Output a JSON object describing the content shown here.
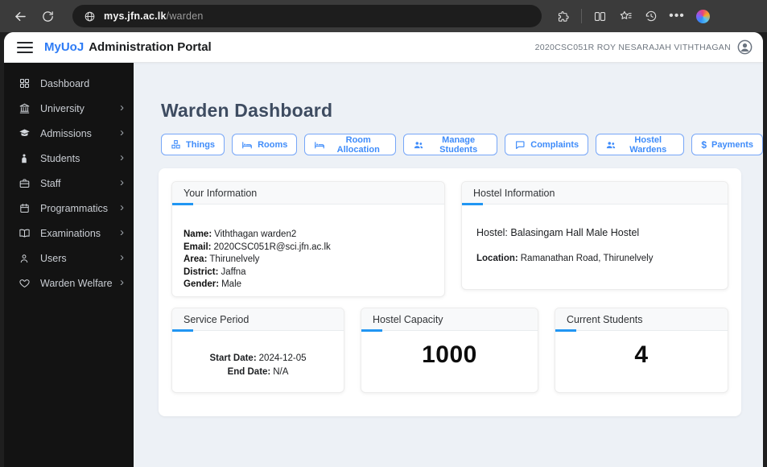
{
  "browser": {
    "url_domain": "mys.jfn.ac.lk",
    "url_path": "/warden",
    "icons": [
      "back-icon",
      "refresh-icon",
      "globe-icon",
      "extensions-icon",
      "split-screen-icon",
      "favorites-icon",
      "history-icon",
      "more-icon",
      "copilot-icon"
    ]
  },
  "header": {
    "brand": "MyUoJ",
    "title": "Administration Portal",
    "user": "2020CSC051R ROY NESARAJAH VITHTHAGAN"
  },
  "sidebar": {
    "items": [
      {
        "label": "Dashboard",
        "icon": "grid-icon",
        "has_submenu": false
      },
      {
        "label": "University",
        "icon": "building-icon",
        "has_submenu": true
      },
      {
        "label": "Admissions",
        "icon": "graduation-cap-icon",
        "has_submenu": true
      },
      {
        "label": "Students",
        "icon": "student-icon",
        "has_submenu": true
      },
      {
        "label": "Staff",
        "icon": "briefcase-icon",
        "has_submenu": true
      },
      {
        "label": "Programmatics",
        "icon": "calendar-icon",
        "has_submenu": true
      },
      {
        "label": "Examinations",
        "icon": "open-book-icon",
        "has_submenu": true
      },
      {
        "label": "Users",
        "icon": "user-icon",
        "has_submenu": true
      },
      {
        "label": "Warden Welfare",
        "icon": "heart-icon",
        "has_submenu": true
      }
    ]
  },
  "main": {
    "page_title": "Warden Dashboard",
    "actions": [
      {
        "label": "Things",
        "icon": "boxes-icon"
      },
      {
        "label": "Rooms",
        "icon": "bed-icon"
      },
      {
        "label": "Room Allocation",
        "icon": "bed-icon"
      },
      {
        "label": "Manage Students",
        "icon": "users-icon"
      },
      {
        "label": "Complaints",
        "icon": "chat-icon"
      },
      {
        "label": "Hostel Wardens",
        "icon": "users-icon"
      },
      {
        "label": "Payments",
        "icon": "dollar-icon"
      }
    ],
    "your_information": {
      "title": "Your Information",
      "fields": [
        {
          "label": "Name:",
          "value": "Viththagan warden2"
        },
        {
          "label": "Email:",
          "value": "2020CSC051R@sci.jfn.ac.lk"
        },
        {
          "label": "Area:",
          "value": "Thirunelvely"
        },
        {
          "label": "District:",
          "value": "Jaffna"
        },
        {
          "label": "Gender:",
          "value": "Male"
        }
      ]
    },
    "hostel_information": {
      "title": "Hostel Information",
      "hostel_line": "Hostel: Balasingam Hall Male Hostel",
      "location_label": "Location:",
      "location_value": "Ramanathan Road, Thirunelvely"
    },
    "service_period": {
      "title": "Service Period",
      "start_label": "Start Date:",
      "start_value": "2024-12-05",
      "end_label": "End Date:",
      "end_value": "N/A"
    },
    "hostel_capacity": {
      "title": "Hostel Capacity",
      "value": "1000"
    },
    "current_students": {
      "title": "Current Students",
      "value": "4"
    }
  },
  "colors": {
    "accent_blue": "#2196f3",
    "brand_blue": "#2d7bf5",
    "button_blue": "#3f8cfa",
    "sidebar_bg": "#131313",
    "main_bg": "#edf1f6",
    "toolbar_bg": "#3b3b3b"
  }
}
